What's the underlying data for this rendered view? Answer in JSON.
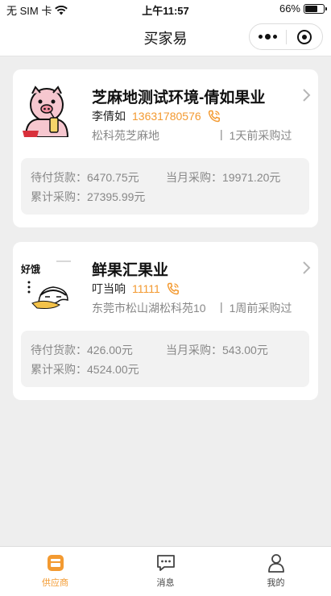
{
  "status_bar": {
    "carrier": "无 SIM 卡",
    "time": "上午11:57",
    "battery_percent": "66%",
    "battery_level": 0.66
  },
  "nav": {
    "title": "买家易"
  },
  "colors": {
    "accent": "#f39a31",
    "background": "#eeeeee",
    "card": "#ffffff"
  },
  "suppliers": [
    {
      "name": "芝麻地测试环境-倩如果业",
      "contact": "李倩如",
      "phone": "13631780576",
      "address": "松科苑芝麻地",
      "last_purchase": "1天前采购过",
      "pending_label": "待付货款：",
      "pending_value": "6470.75元",
      "month_label": "当月采购：",
      "month_value": "19971.20元",
      "total_label": "累计采购：",
      "total_value": "27395.99元",
      "avatar_icon": "pig-drinking-icon"
    },
    {
      "name": "鲜果汇果业",
      "contact": "叮当响",
      "phone": "11111",
      "address": "东莞市松山湖松科苑10",
      "last_purchase": "1周前采购过",
      "pending_label": "待付货款：",
      "pending_value": "426.00元",
      "month_label": "当月采购：",
      "month_value": "543.00元",
      "total_label": "累计采购：",
      "total_value": "4524.00元",
      "avatar_icon": "hungry-character-icon",
      "avatar_text": "好饿"
    }
  ],
  "tabs": [
    {
      "label": "供应商",
      "icon": "store-icon",
      "active": true
    },
    {
      "label": "消息",
      "icon": "message-icon",
      "active": false
    },
    {
      "label": "我的",
      "icon": "user-icon",
      "active": false
    }
  ]
}
